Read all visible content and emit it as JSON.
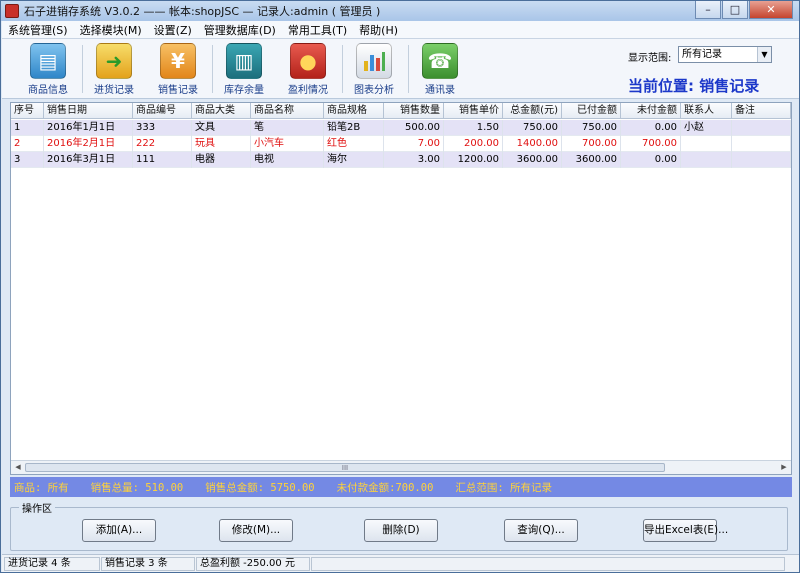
{
  "title": "石子进销存系统 V3.0.2 —— 帐本:shopJSC — 记录人:admin ( 管理员 )",
  "menu": [
    "系统管理(S)",
    "选择模块(M)",
    "设置(Z)",
    "管理数据库(D)",
    "常用工具(T)",
    "帮助(H)"
  ],
  "toolbar": {
    "items": [
      {
        "label": "商品信息",
        "icon": "document-icon"
      },
      {
        "label": "进货记录",
        "icon": "box-in-icon"
      },
      {
        "label": "销售记录",
        "icon": "yen-icon"
      },
      {
        "label": "库存余量",
        "icon": "books-icon"
      },
      {
        "label": "盈利情况",
        "icon": "coins-icon"
      },
      {
        "label": "图表分析",
        "icon": "bar-chart-icon"
      },
      {
        "label": "通讯录",
        "icon": "phone-icon"
      }
    ],
    "range_label": "显示范围:",
    "range_value": "所有记录",
    "location": "当前位置: 销售记录"
  },
  "table": {
    "columns": [
      "序号",
      "销售日期",
      "商品编号",
      "商品大类",
      "商品名称",
      "商品规格",
      "销售数量",
      "销售单价",
      "总金额(元)",
      "已付金额",
      "未付金额",
      "联系人",
      "备注"
    ],
    "rows": [
      [
        "1",
        "2016年1月1日",
        "333",
        "文具",
        "笔",
        "铅笔2B",
        "500.00",
        "1.50",
        "750.00",
        "750.00",
        "0.00",
        "小赵",
        ""
      ],
      [
        "2",
        "2016年2月1日",
        "222",
        "玩具",
        "小汽车",
        "红色",
        "7.00",
        "200.00",
        "1400.00",
        "700.00",
        "700.00",
        "",
        ""
      ],
      [
        "3",
        "2016年3月1日",
        "111",
        "电器",
        "电视",
        "海尔",
        "3.00",
        "1200.00",
        "3600.00",
        "3600.00",
        "0.00",
        "",
        ""
      ]
    ],
    "scroll_grip": "III"
  },
  "summary": {
    "goods": "商品: 所有",
    "total_qty": "销售总量: 510.00",
    "total_amount": "销售总金额: 5750.00",
    "unpaid": "未付款金额:700.00",
    "range": "汇总范围: 所有记录"
  },
  "ops": {
    "title": "操作区",
    "add": "添加(A)...",
    "edit": "修改(M)...",
    "delete": "删除(D)",
    "query": "查询(Q)...",
    "export": "导出Excel表(E)..."
  },
  "status": {
    "purchase": "进货记录 4 条",
    "sales": "销售记录 3 条",
    "profit": "总盈利额 -250.00 元"
  },
  "colors": {
    "accent": "#1c38c9",
    "summary_bg": "#7489e4",
    "summary_text": "#ffd23a",
    "highlight_row": "#e01010"
  }
}
